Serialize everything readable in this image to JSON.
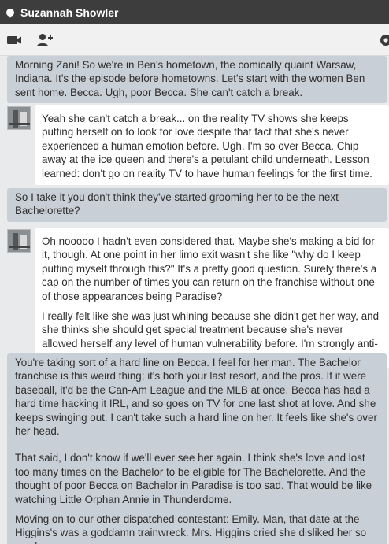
{
  "window": {
    "title": "Suzannah Showler"
  },
  "toolbar": {
    "video_icon": "video-camera-icon",
    "add_user_icon": "add-user-icon",
    "settings_icon": "gear-icon"
  },
  "messages": [
    {
      "side": "out",
      "paragraphs": [
        "Morning Zani! So we're in Ben's hometown, the comically quaint Warsaw, Indiana. It's the episode before hometowns. Let's start with the women Ben sent home. Becca. Ugh, poor Becca. She can't catch a break."
      ]
    },
    {
      "side": "in",
      "paragraphs": [
        "Yeah she can't catch a break... on the reality TV shows she keeps putting herself on to look for love despite that fact that she's never experienced a human emotion before. Ugh, I'm so over Becca. Chip away at the ice queen and there's a petulant child underneath. Lesson learned: don't go on reality TV to have human feelings for the first time."
      ]
    },
    {
      "side": "out",
      "paragraphs": [
        "So I take it you don't think they've started grooming her to be the next Bachelorette?"
      ]
    },
    {
      "side": "in",
      "paragraphs": [
        "Oh nooooo I hadn't even considered that. Maybe she's making a bid for it, though. At one point in her limo exit wasn't she like \"why do I keep putting myself through this?\" It's a pretty good question. Surely there's a cap on the number of times you can return on the franchise without one of those appearances being Paradise?",
        "I really felt like she was just whining because she didn't get her way, and she thinks she should get special treatment because she's never allowed herself any level of human vulnerability before. I'm strongly anti-Becca."
      ]
    },
    {
      "side": "out",
      "paragraphs": [
        "You're taking sort of a hard line on Becca. I feel for her man. The Bachelor franchise is this weird thing; it's both your last resort, and the pros. If it were baseball, it'd be the Can-Am League and the MLB at once. Becca has had a hard time hacking it IRL, and so goes on TV for one last shot at love. And she keeps swinging out. I can't take such a hard line on her. It feels like she's over her head.",
        "That said, I don't know if we'll ever see her again. I think she's love and lost too many times on the Bachelor to be eligible for The Bachelorette. And the thought of poor Becca on Bachelor in Paradise is too sad. That would be like watching Little Orphan Annie in Thunderdome.",
        "Moving on to our other dispatched contestant: Emily. Man, that date at the Higgins's was a goddamn trainwreck. Mrs. Higgins cried she disliked her so much."
      ]
    }
  ]
}
